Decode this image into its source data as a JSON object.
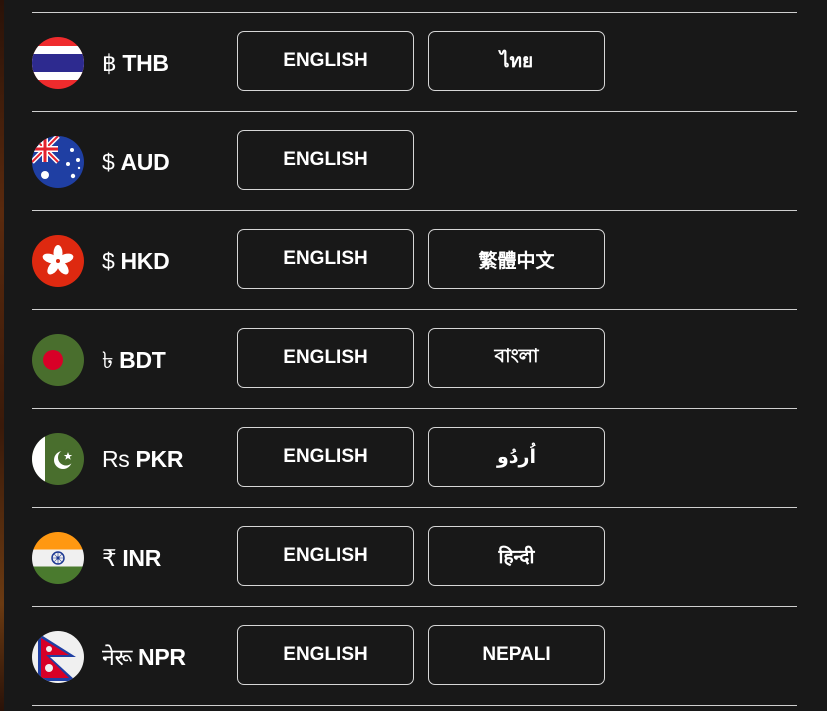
{
  "rows": [
    {
      "symbol": "฿",
      "code": "THB",
      "flag": "thailand-flag-icon",
      "languages": [
        "ENGLISH",
        "ไทย"
      ]
    },
    {
      "symbol": "$",
      "code": "AUD",
      "flag": "australia-flag-icon",
      "languages": [
        "ENGLISH"
      ]
    },
    {
      "symbol": "$",
      "code": "HKD",
      "flag": "hong-kong-flag-icon",
      "languages": [
        "ENGLISH",
        "繁體中文"
      ]
    },
    {
      "symbol": "৳",
      "code": "BDT",
      "flag": "bangladesh-flag-icon",
      "languages": [
        "ENGLISH",
        "বাংলা"
      ]
    },
    {
      "symbol": "Rs",
      "code": "PKR",
      "flag": "pakistan-flag-icon",
      "languages": [
        "ENGLISH",
        "اُردُو"
      ]
    },
    {
      "symbol": "₹",
      "code": "INR",
      "flag": "india-flag-icon",
      "languages": [
        "ENGLISH",
        "हिन्दी"
      ]
    },
    {
      "symbol": "नेरू",
      "code": "NPR",
      "flag": "nepal-flag-icon",
      "languages": [
        "ENGLISH",
        "NEPALI"
      ]
    }
  ],
  "colors": {
    "background": "#181818",
    "divider": "#cfcfcf",
    "button_border": "#d6d6d6",
    "text": "#ffffff"
  }
}
